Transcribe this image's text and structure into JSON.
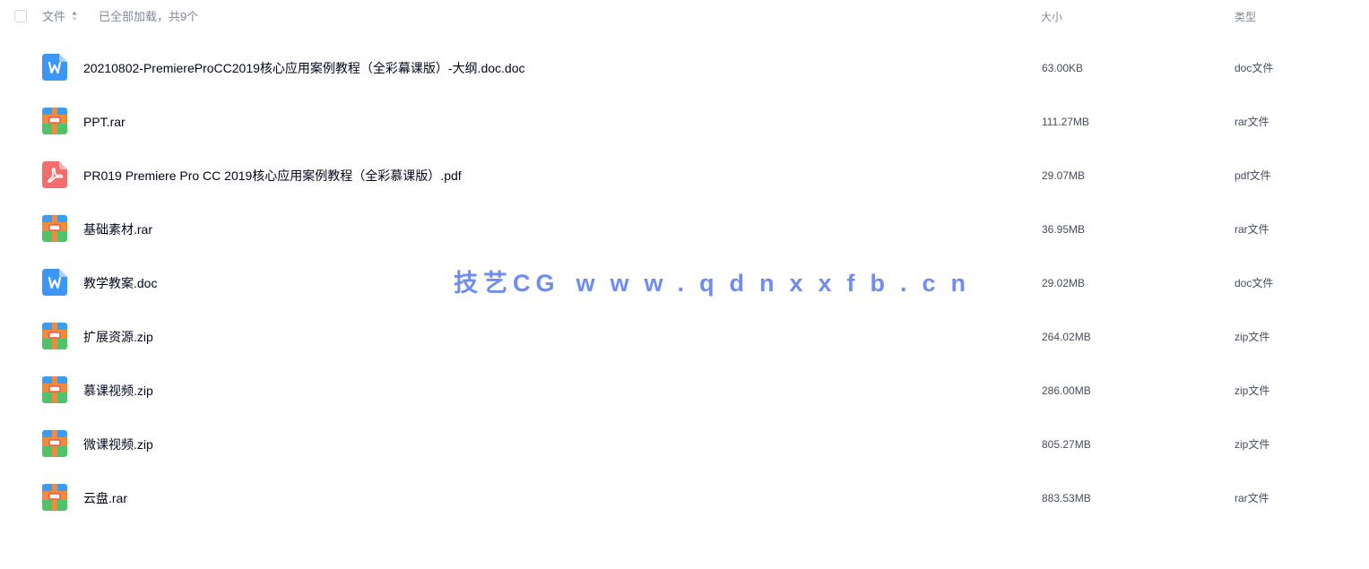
{
  "header": {
    "col_name": "文件",
    "load_status": "已全部加载，共9个",
    "col_size": "大小",
    "col_type": "类型"
  },
  "files": [
    {
      "name": "20210802-PremiereProCC2019核心应用案例教程（全彩幕课版）-大纲.doc.doc",
      "size": "63.00KB",
      "type": "doc文件",
      "icon": "word-doc-icon"
    },
    {
      "name": "PPT.rar",
      "size": "111.27MB",
      "type": "rar文件",
      "icon": "archive-icon"
    },
    {
      "name": "PR019 Premiere Pro CC 2019核心应用案例教程（全彩慕课版）.pdf",
      "size": "29.07MB",
      "type": "pdf文件",
      "icon": "pdf-icon"
    },
    {
      "name": "基础素材.rar",
      "size": "36.95MB",
      "type": "rar文件",
      "icon": "archive-icon"
    },
    {
      "name": "教学教案.doc",
      "size": "29.02MB",
      "type": "doc文件",
      "icon": "word-doc-icon"
    },
    {
      "name": "扩展资源.zip",
      "size": "264.02MB",
      "type": "zip文件",
      "icon": "archive-icon"
    },
    {
      "name": "慕课视频.zip",
      "size": "286.00MB",
      "type": "zip文件",
      "icon": "archive-icon"
    },
    {
      "name": "微课视频.zip",
      "size": "805.27MB",
      "type": "zip文件",
      "icon": "archive-icon"
    },
    {
      "name": "云盘.rar",
      "size": "883.53MB",
      "type": "rar文件",
      "icon": "archive-icon"
    }
  ],
  "watermark": {
    "brand": "技艺CG",
    "url": "www.qdnxxfb.cn"
  },
  "colors": {
    "word_blue": "#3d95f5",
    "pdf_red": "#f36d6d",
    "archive_blue": "#3a9cf2",
    "archive_orange": "#f28a3c",
    "archive_green": "#4fc26a",
    "watermark": "#6f8df0"
  }
}
